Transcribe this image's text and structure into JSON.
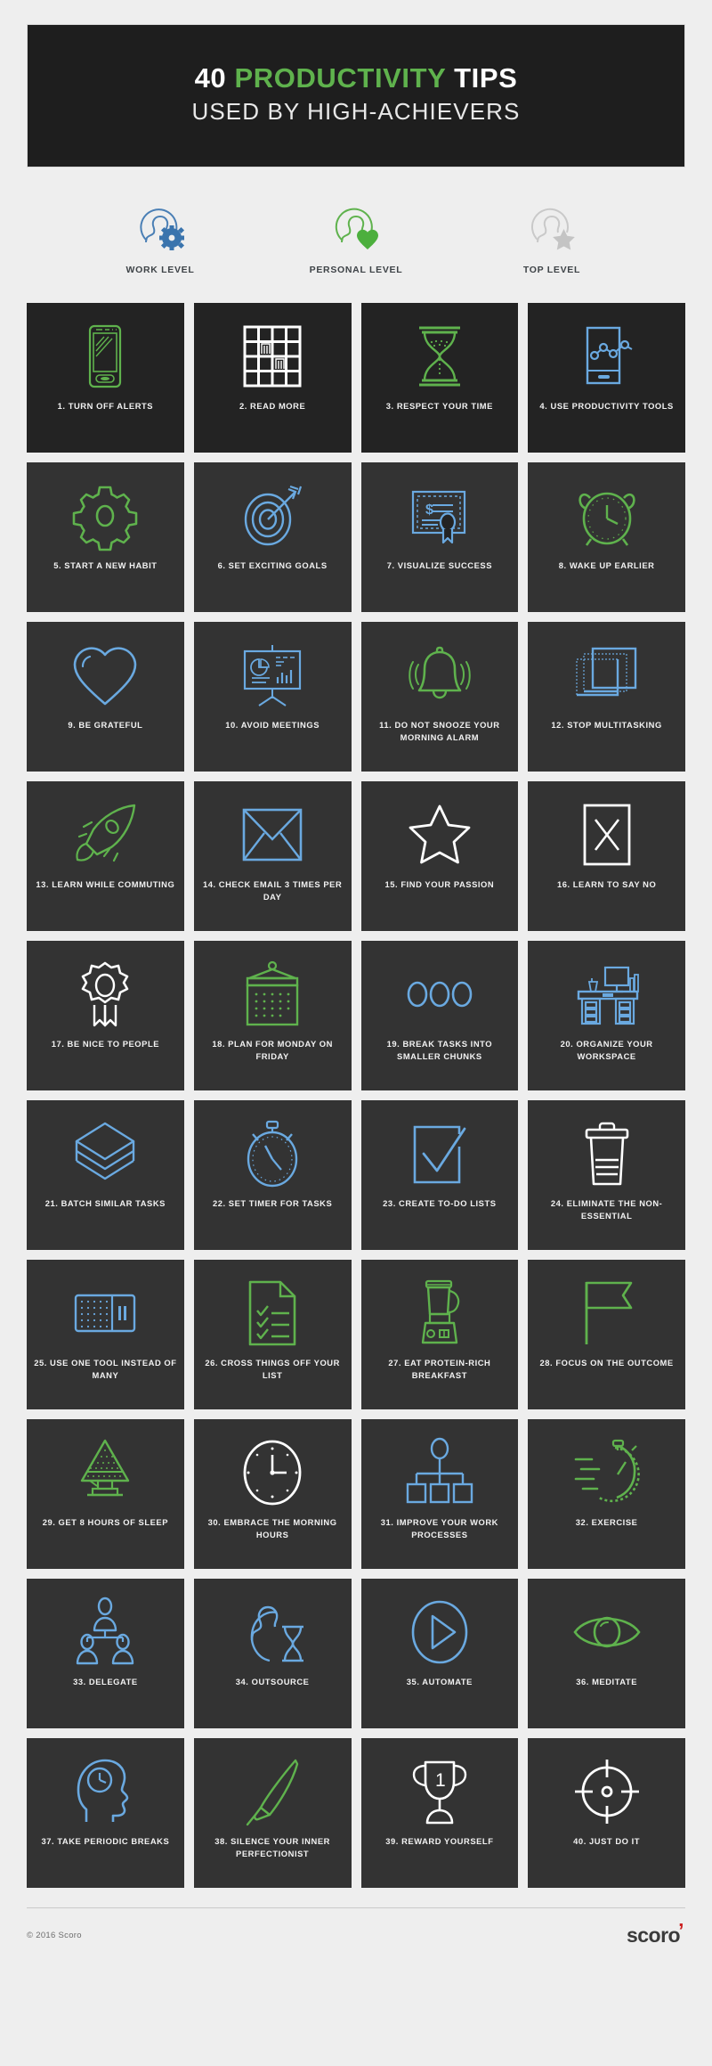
{
  "colors": {
    "background": "#eeeeee",
    "header_bg": "#1e1e1e",
    "tile_bg_dark": "#232323",
    "tile_bg": "#333333",
    "green": "#5fb24d",
    "blue": "#6aa9e0",
    "white": "#ffffff",
    "gray": "#c4c4c4",
    "logo_accent": "#cc2222"
  },
  "header": {
    "title_prefix": "40 ",
    "title_highlight": "PRODUCTIVITY",
    "title_suffix": " TIPS",
    "subtitle": "USED BY HIGH-ACHIEVERS"
  },
  "legend": {
    "items": [
      {
        "label": "WORK LEVEL",
        "icon": "person-gear-icon",
        "color": "#4a7fb5"
      },
      {
        "label": "PERSONAL LEVEL",
        "icon": "person-heart-icon",
        "color": "#5fb24d"
      },
      {
        "label": "TOP LEVEL",
        "icon": "person-star-icon",
        "color": "#c4c4c4"
      }
    ]
  },
  "tips": [
    {
      "num": "1.",
      "label": "1. TURN OFF ALERTS",
      "icon": "smartphone-icon",
      "level": "personal",
      "color": "#5fb24d"
    },
    {
      "num": "2.",
      "label": "2. READ MORE",
      "icon": "bookshelf-icon",
      "level": "top",
      "color": "#ffffff"
    },
    {
      "num": "3.",
      "label": "3. RESPECT YOUR TIME",
      "icon": "hourglass-icon",
      "level": "personal",
      "color": "#5fb24d"
    },
    {
      "num": "4.",
      "label": "4.  USE PRODUCTIVITY TOOLS",
      "icon": "mobile-chart-icon",
      "level": "work",
      "color": "#6aa9e0"
    },
    {
      "num": "5.",
      "label": "5. START A NEW HABIT",
      "icon": "gear-icon",
      "level": "personal",
      "color": "#5fb24d"
    },
    {
      "num": "6.",
      "label": "6. SET EXCITING GOALS",
      "icon": "target-arrow-icon",
      "level": "work",
      "color": "#6aa9e0"
    },
    {
      "num": "7.",
      "label": "7. VISUALIZE SUCCESS",
      "icon": "certificate-icon",
      "level": "work",
      "color": "#6aa9e0"
    },
    {
      "num": "8.",
      "label": "8. WAKE UP EARLIER",
      "icon": "alarm-clock-icon",
      "level": "personal",
      "color": "#5fb24d"
    },
    {
      "num": "9.",
      "label": "9. BE GRATEFUL",
      "icon": "heart-icon",
      "level": "work",
      "color": "#6aa9e0"
    },
    {
      "num": "10.",
      "label": "10. AVOID MEETINGS",
      "icon": "presentation-board-icon",
      "level": "work",
      "color": "#6aa9e0"
    },
    {
      "num": "11.",
      "label": "11. DO NOT SNOOZE YOUR MORNING ALARM",
      "icon": "ringing-bell-icon",
      "level": "personal",
      "color": "#5fb24d"
    },
    {
      "num": "12.",
      "label": "12. STOP MULTITASKING",
      "icon": "stacked-windows-icon",
      "level": "work",
      "color": "#6aa9e0"
    },
    {
      "num": "13.",
      "label": "13. LEARN WHILE COMMUTING",
      "icon": "rocket-icon",
      "level": "personal",
      "color": "#5fb24d"
    },
    {
      "num": "14.",
      "label": "14. CHECK EMAIL 3 TIMES PER DAY",
      "icon": "envelope-icon",
      "level": "work",
      "color": "#6aa9e0"
    },
    {
      "num": "15.",
      "label": "15. FIND YOUR PASSION",
      "icon": "star-icon",
      "level": "top",
      "color": "#ffffff"
    },
    {
      "num": "16.",
      "label": "16. LEARN TO SAY NO",
      "icon": "x-box-icon",
      "level": "top",
      "color": "#ffffff"
    },
    {
      "num": "17.",
      "label": "17. BE NICE TO PEOPLE",
      "icon": "award-ribbon-icon",
      "level": "top",
      "color": "#ffffff"
    },
    {
      "num": "18.",
      "label": "18. PLAN FOR MONDAY ON FRIDAY",
      "icon": "wall-calendar-icon",
      "level": "personal",
      "color": "#5fb24d"
    },
    {
      "num": "19.",
      "label": "19. BREAK TASKS INTO SMALLER CHUNKS",
      "icon": "three-dots-icon",
      "level": "work",
      "color": "#6aa9e0"
    },
    {
      "num": "20.",
      "label": "20. ORGANIZE YOUR WORKSPACE",
      "icon": "desk-icon",
      "level": "work",
      "color": "#6aa9e0"
    },
    {
      "num": "21.",
      "label": "21. BATCH SIMILAR TASKS",
      "icon": "layers-icon",
      "level": "work",
      "color": "#6aa9e0"
    },
    {
      "num": "22.",
      "label": "22. SET TIMER FOR TASKS",
      "icon": "stopwatch-icon",
      "level": "work",
      "color": "#6aa9e0"
    },
    {
      "num": "23.",
      "label": "23. CREATE TO-DO LISTS",
      "icon": "checkbox-icon",
      "level": "work",
      "color": "#6aa9e0"
    },
    {
      "num": "24.",
      "label": "24. ELIMINATE THE NON-ESSENTIAL",
      "icon": "trash-can-icon",
      "level": "top",
      "color": "#ffffff"
    },
    {
      "num": "25.",
      "label": "25. USE ONE TOOL INSTEAD OF MANY",
      "icon": "toolbox-icon",
      "level": "work",
      "color": "#6aa9e0"
    },
    {
      "num": "26.",
      "label": "26. CROSS THINGS OFF YOUR LIST",
      "icon": "checklist-document-icon",
      "level": "personal",
      "color": "#5fb24d"
    },
    {
      "num": "27.",
      "label": "27. EAT PROTEIN-RICH BREAKFAST",
      "icon": "blender-icon",
      "level": "personal",
      "color": "#5fb24d"
    },
    {
      "num": "28.",
      "label": "28. FOCUS ON THE OUTCOME",
      "icon": "flag-icon",
      "level": "personal",
      "color": "#5fb24d"
    },
    {
      "num": "29.",
      "label": "29. GET 8 HOURS OF SLEEP",
      "icon": "table-lamp-icon",
      "level": "personal",
      "color": "#5fb24d"
    },
    {
      "num": "30.",
      "label": "30. EMBRACE THE MORNING HOURS",
      "icon": "wall-clock-icon",
      "level": "top",
      "color": "#ffffff"
    },
    {
      "num": "31.",
      "label": "31. IMPROVE YOUR WORK PROCESSES",
      "icon": "org-chart-icon",
      "level": "work",
      "color": "#6aa9e0"
    },
    {
      "num": "32.",
      "label": "32. EXERCISE",
      "icon": "running-stopwatch-icon",
      "level": "personal",
      "color": "#5fb24d"
    },
    {
      "num": "33.",
      "label": "33. DELEGATE",
      "icon": "people-network-icon",
      "level": "work",
      "color": "#6aa9e0"
    },
    {
      "num": "34.",
      "label": "34. OUTSOURCE",
      "icon": "person-hourglass-icon",
      "level": "work",
      "color": "#6aa9e0"
    },
    {
      "num": "35.",
      "label": "35. AUTOMATE",
      "icon": "play-button-icon",
      "level": "work",
      "color": "#6aa9e0"
    },
    {
      "num": "36.",
      "label": "36. MEDITATE",
      "icon": "eye-icon",
      "level": "personal",
      "color": "#5fb24d"
    },
    {
      "num": "37.",
      "label": "37. TAKE PERIODIC BREAKS",
      "icon": "head-clock-icon",
      "level": "work",
      "color": "#6aa9e0"
    },
    {
      "num": "38.",
      "label": "38. SILENCE YOUR INNER PERFECTIONIST",
      "icon": "paintbrush-icon",
      "level": "personal",
      "color": "#5fb24d"
    },
    {
      "num": "39.",
      "label": "39. REWARD YOURSELF",
      "icon": "trophy-icon",
      "level": "top",
      "color": "#ffffff"
    },
    {
      "num": "40.",
      "label": "40. JUST DO IT",
      "icon": "crosshair-target-icon",
      "level": "top",
      "color": "#ffffff"
    }
  ],
  "footer": {
    "copyright": "© 2016 Scoro",
    "logo_text": "scoro",
    "logo_tick": "’"
  }
}
